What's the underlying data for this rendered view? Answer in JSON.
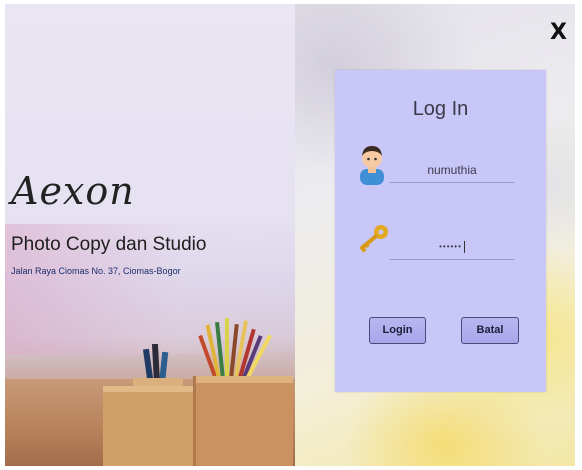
{
  "brand": {
    "name": "Aexon",
    "subtitle": "Photo Copy dan Studio",
    "address": "Jalan Raya Ciomas No. 37, Ciomas-Bogor"
  },
  "window": {
    "close_label": "X"
  },
  "login": {
    "title": "Log In",
    "username_value": "numuthia",
    "password_value": "••••••",
    "login_button": "Login",
    "cancel_button": "Batal"
  },
  "icons": {
    "user": "user-avatar-icon",
    "password": "key-icon",
    "close": "close-icon"
  },
  "colors": {
    "panel": "#c9c6f8",
    "button": "#b3b0ee",
    "address_text": "#1b2d6b"
  }
}
